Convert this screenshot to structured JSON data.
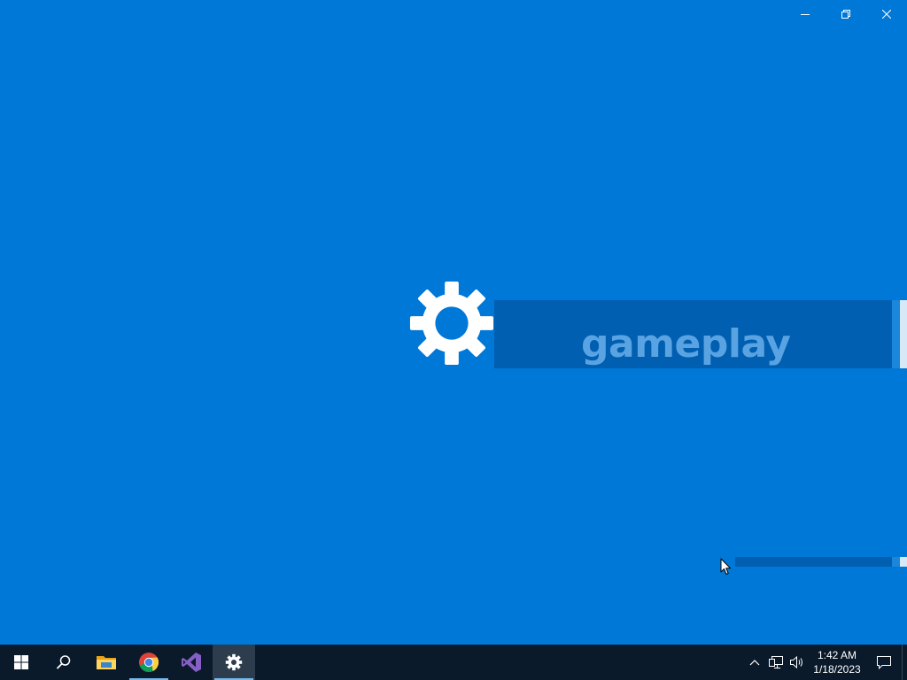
{
  "window": {
    "caption_buttons": [
      {
        "name": "minimize",
        "icon": "minimize-icon"
      },
      {
        "name": "restore",
        "icon": "restore-icon"
      },
      {
        "name": "close",
        "icon": "close-icon"
      }
    ]
  },
  "splash": {
    "icon": "gear-icon",
    "title": "gameplay",
    "colors": {
      "background": "#0078d7",
      "banner": "#005fb0",
      "text": "#5aa3e3",
      "icon": "#ffffff"
    }
  },
  "progress": {
    "label": "",
    "value": 0.92
  },
  "taskbar": {
    "items": [
      {
        "name": "start",
        "icon": "windows-logo-icon"
      },
      {
        "name": "search",
        "icon": "search-icon"
      },
      {
        "name": "file-explorer",
        "icon": "folder-icon"
      },
      {
        "name": "chrome",
        "icon": "chrome-icon",
        "running": true
      },
      {
        "name": "visual-studio",
        "icon": "visual-studio-icon"
      },
      {
        "name": "settings",
        "icon": "gear-icon",
        "running": true,
        "active": true
      }
    ],
    "tray": {
      "icons": [
        "chevron-up-icon",
        "network-icon",
        "volume-icon"
      ],
      "time": "1:42 AM",
      "date": "1/18/2023",
      "notification_icon": "action-center-icon"
    }
  }
}
